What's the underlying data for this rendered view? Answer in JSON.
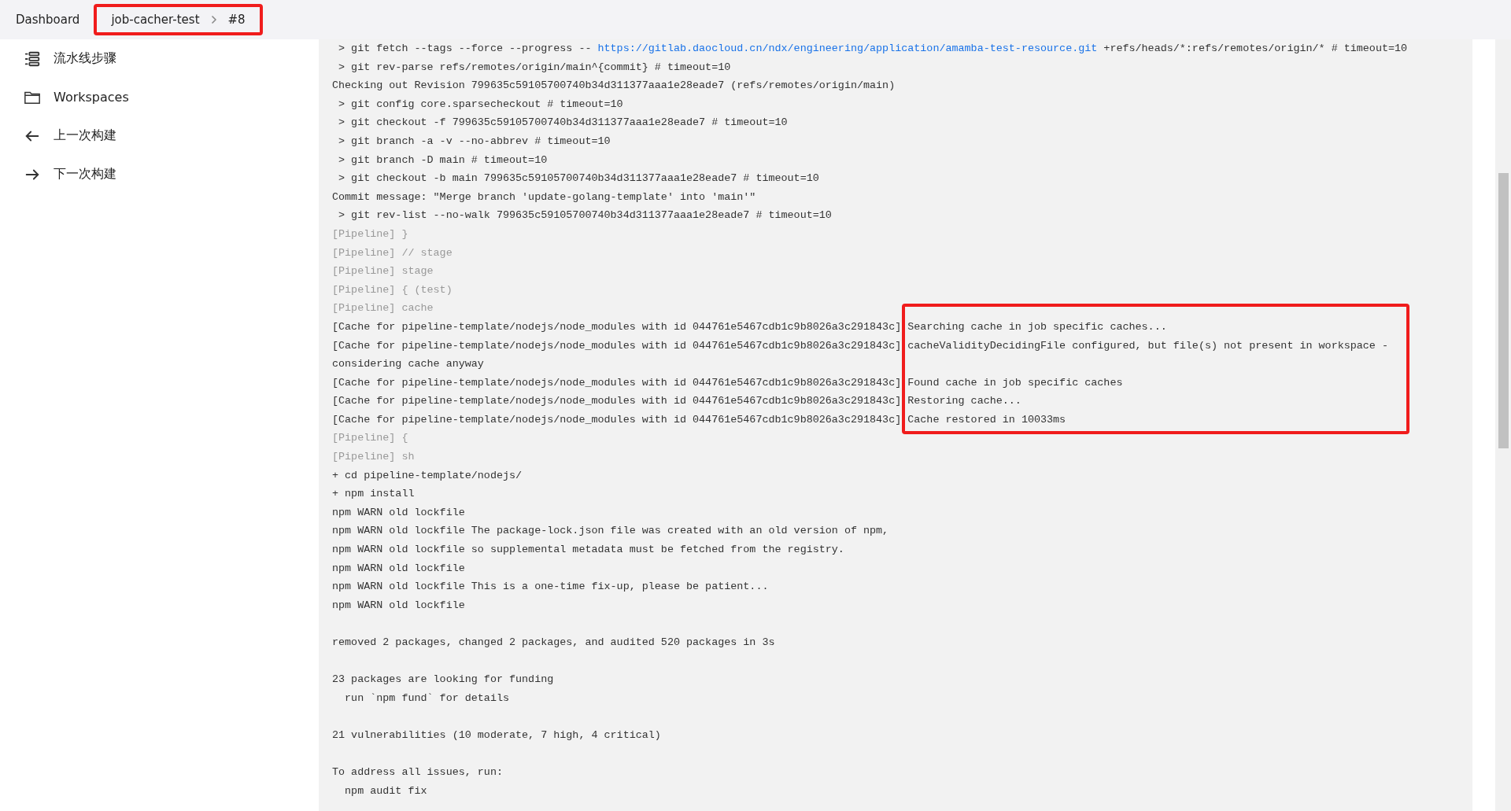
{
  "breadcrumb": [
    {
      "label": "Dashboard",
      "highlighted": false
    },
    {
      "label": "job-cacher-test",
      "highlighted": true
    },
    {
      "label": "#8",
      "highlighted": true
    }
  ],
  "sidebar": {
    "items": [
      {
        "label": "流水线步骤",
        "kind": "steps"
      },
      {
        "label": "Workspaces",
        "kind": "folder"
      },
      {
        "label": "上一次构建",
        "kind": "prev"
      },
      {
        "label": "下一次构建",
        "kind": "next"
      }
    ]
  },
  "console": {
    "lines": [
      {
        "kind": "link",
        "text": " > git fetch --tags --force --progress -- ",
        "link": "https://gitlab.daocloud.cn/ndx/engineering/application/amamba-test-resource.git",
        "after": " +refs/heads/*:refs/remotes/origin/* # timeout=10"
      },
      {
        "kind": "text",
        "text": " > git rev-parse refs/remotes/origin/main^{commit} # timeout=10"
      },
      {
        "kind": "text",
        "text": "Checking out Revision 799635c59105700740b34d311377aaa1e28eade7 (refs/remotes/origin/main)"
      },
      {
        "kind": "text",
        "text": " > git config core.sparsecheckout # timeout=10"
      },
      {
        "kind": "text",
        "text": " > git checkout -f 799635c59105700740b34d311377aaa1e28eade7 # timeout=10"
      },
      {
        "kind": "text",
        "text": " > git branch -a -v --no-abbrev # timeout=10"
      },
      {
        "kind": "text",
        "text": " > git branch -D main # timeout=10"
      },
      {
        "kind": "text",
        "text": " > git checkout -b main 799635c59105700740b34d311377aaa1e28eade7 # timeout=10"
      },
      {
        "kind": "text",
        "text": "Commit message: \"Merge branch 'update-golang-template' into 'main'\""
      },
      {
        "kind": "text",
        "text": " > git rev-list --no-walk 799635c59105700740b34d311377aaa1e28eade7 # timeout=10"
      },
      {
        "kind": "pipeline",
        "text": "[Pipeline] }"
      },
      {
        "kind": "pipeline",
        "text": "[Pipeline] // stage"
      },
      {
        "kind": "pipeline",
        "text": "[Pipeline] stage"
      },
      {
        "kind": "pipeline",
        "text": "[Pipeline] { (test)"
      },
      {
        "kind": "pipeline",
        "text": "[Pipeline] cache"
      },
      {
        "kind": "cache",
        "text": "[Cache for pipeline-template/nodejs/node_modules with id 044761e5467cdb1c9b8026a3c291843c]",
        "message": "Searching cache in job specific caches...",
        "highlighted": true
      },
      {
        "kind": "cache",
        "text": "[Cache for pipeline-template/nodejs/node_modules with id 044761e5467cdb1c9b8026a3c291843c]",
        "message": "cacheValidityDecidingFile configured, but file(s) not present in workspace -",
        "highlighted": true
      },
      {
        "kind": "text",
        "text": "considering cache anyway"
      },
      {
        "kind": "cache",
        "text": "[Cache for pipeline-template/nodejs/node_modules with id 044761e5467cdb1c9b8026a3c291843c]",
        "message": "Found cache in job specific caches",
        "highlighted": true
      },
      {
        "kind": "cache",
        "text": "[Cache for pipeline-template/nodejs/node_modules with id 044761e5467cdb1c9b8026a3c291843c]",
        "message": "Restoring cache...",
        "highlighted": true
      },
      {
        "kind": "cache",
        "text": "[Cache for pipeline-template/nodejs/node_modules with id 044761e5467cdb1c9b8026a3c291843c]",
        "message": "Cache restored in 10033ms",
        "highlighted": true
      },
      {
        "kind": "pipeline",
        "text": "[Pipeline] {"
      },
      {
        "kind": "pipeline",
        "text": "[Pipeline] sh"
      },
      {
        "kind": "text",
        "text": "+ cd pipeline-template/nodejs/"
      },
      {
        "kind": "text",
        "text": "+ npm install"
      },
      {
        "kind": "text",
        "text": "npm WARN old lockfile"
      },
      {
        "kind": "text",
        "text": "npm WARN old lockfile The package-lock.json file was created with an old version of npm,"
      },
      {
        "kind": "text",
        "text": "npm WARN old lockfile so supplemental metadata must be fetched from the registry."
      },
      {
        "kind": "text",
        "text": "npm WARN old lockfile"
      },
      {
        "kind": "text",
        "text": "npm WARN old lockfile This is a one-time fix-up, please be patient..."
      },
      {
        "kind": "text",
        "text": "npm WARN old lockfile"
      },
      {
        "kind": "blank"
      },
      {
        "kind": "text",
        "text": "removed 2 packages, changed 2 packages, and audited 520 packages in 3s"
      },
      {
        "kind": "blank"
      },
      {
        "kind": "text",
        "text": "23 packages are looking for funding"
      },
      {
        "kind": "text",
        "text": "  run `npm fund` for details"
      },
      {
        "kind": "blank"
      },
      {
        "kind": "text",
        "text": "21 vulnerabilities (10 moderate, 7 high, 4 critical)"
      },
      {
        "kind": "blank"
      },
      {
        "kind": "text",
        "text": "To address all issues, run:"
      },
      {
        "kind": "text",
        "text": "  npm audit fix"
      }
    ]
  }
}
